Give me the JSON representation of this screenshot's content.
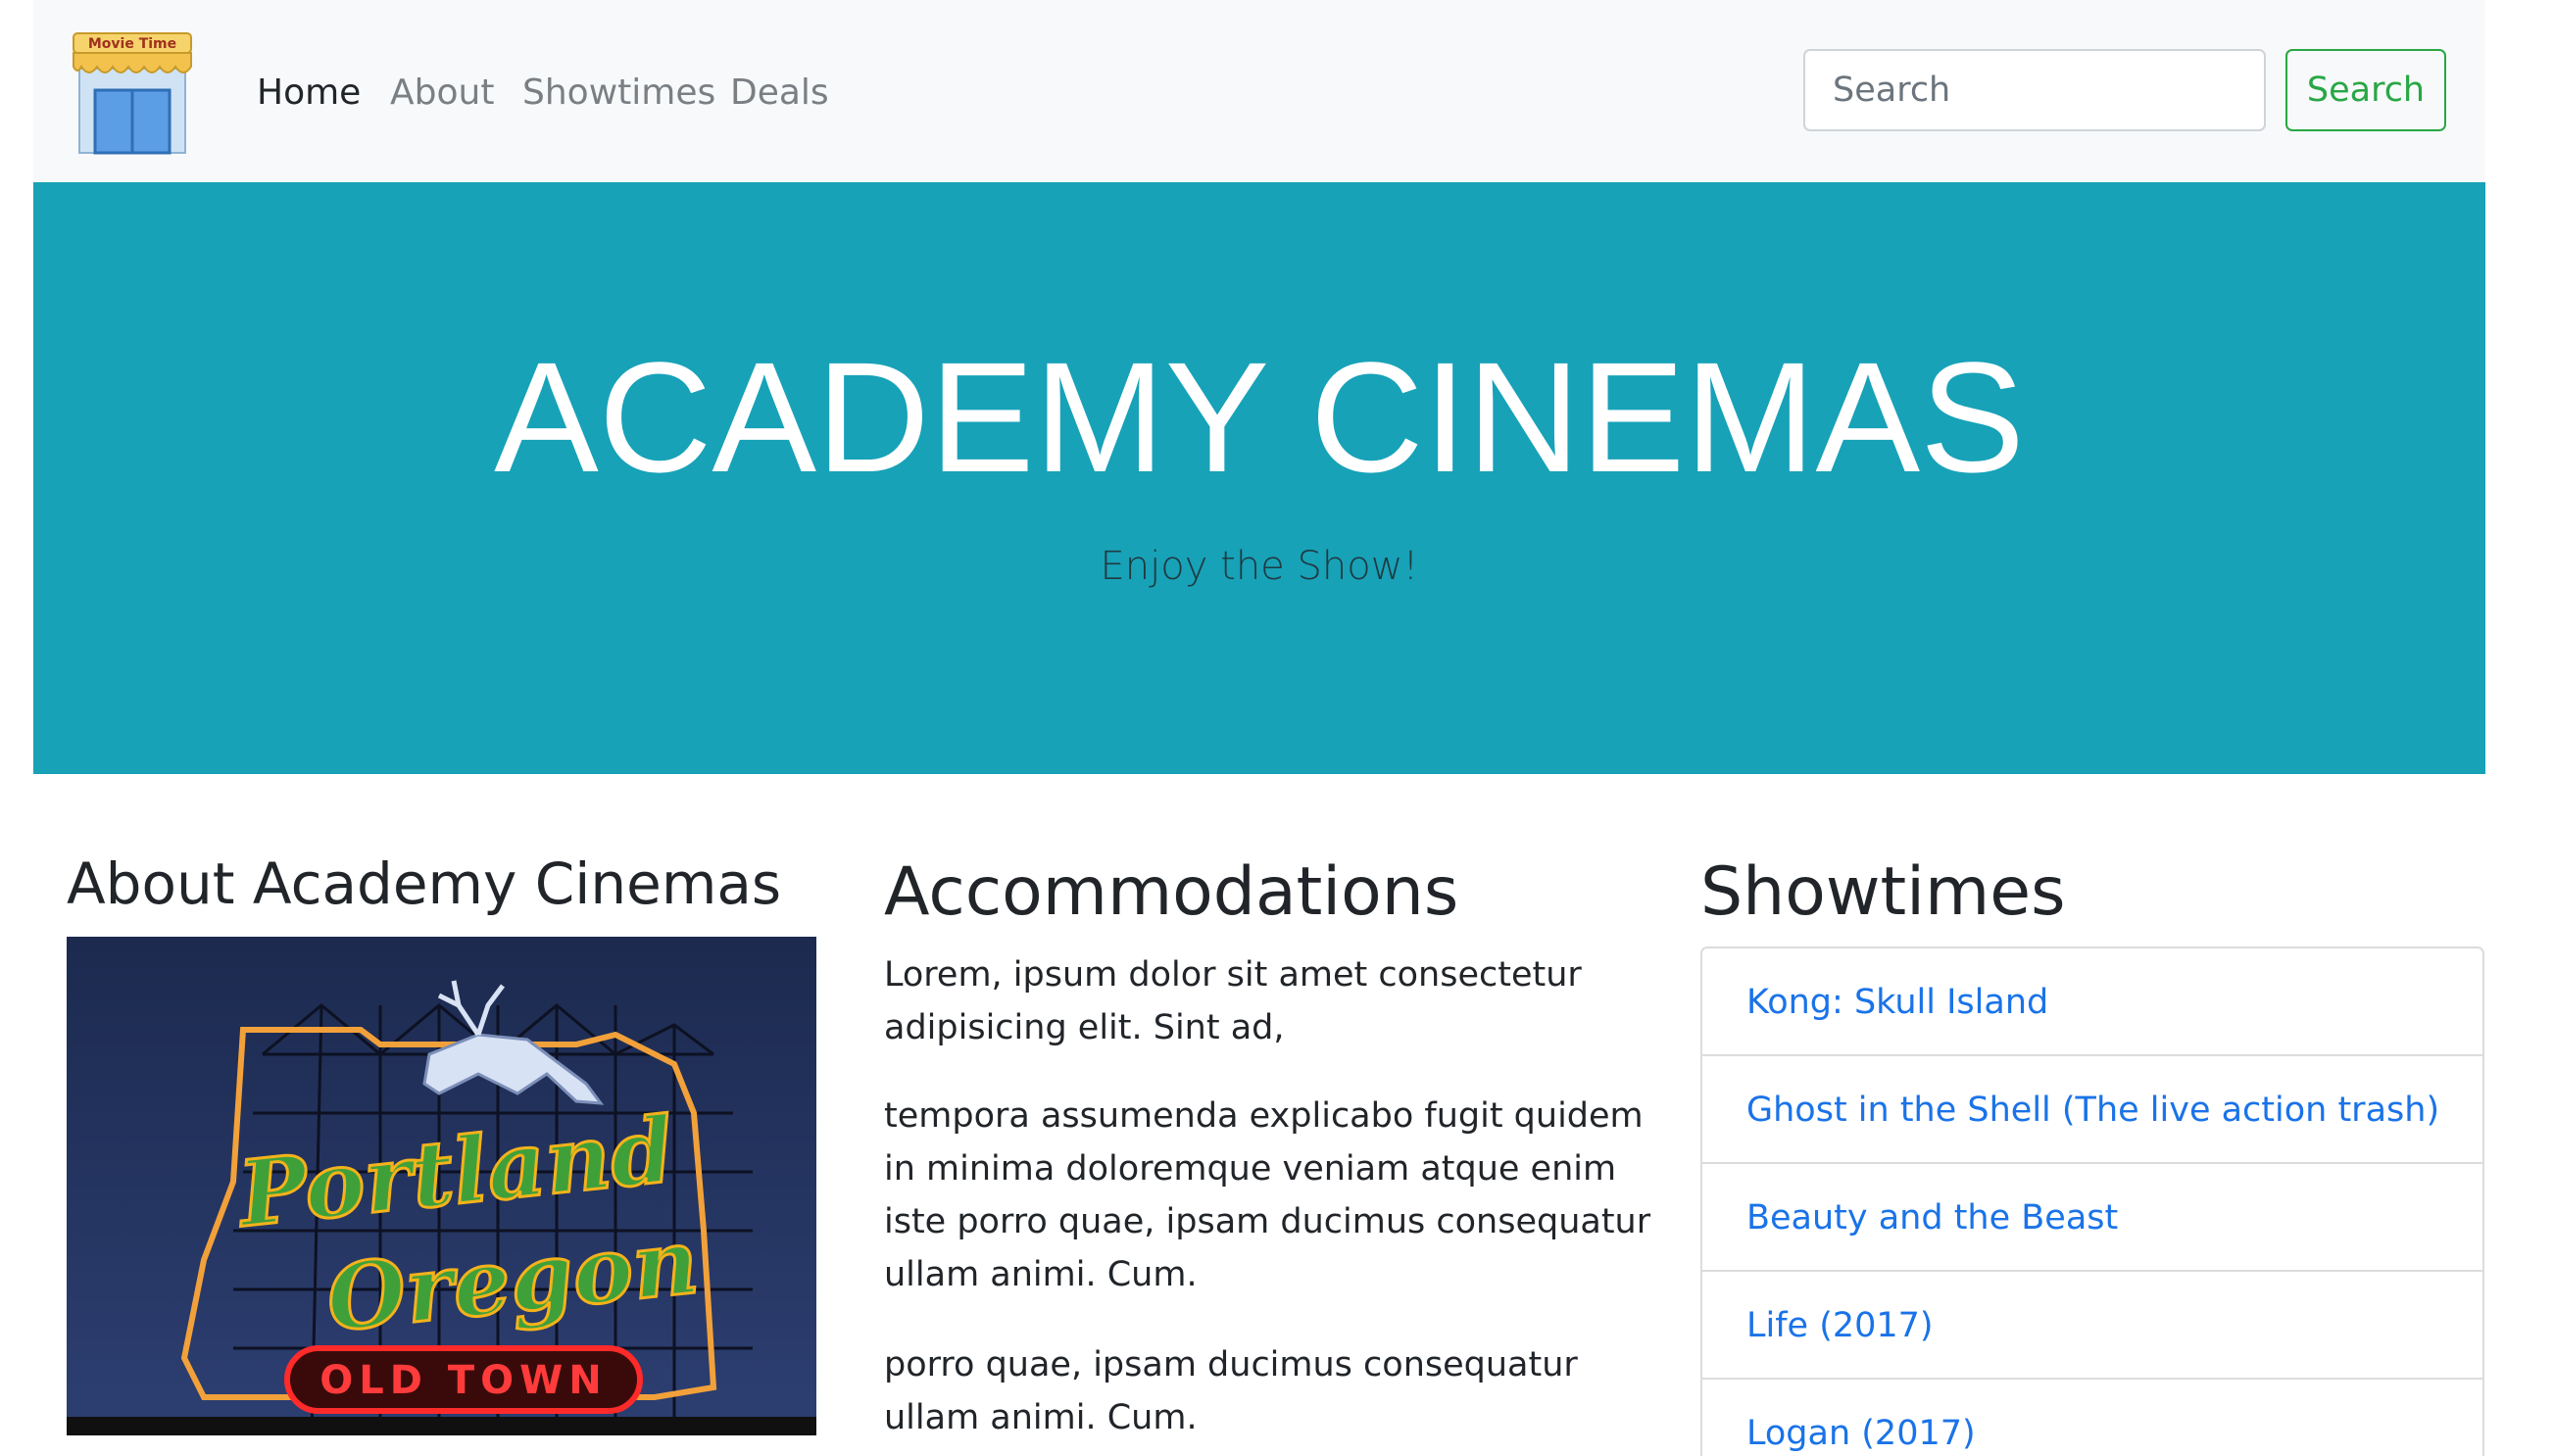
{
  "navbar": {
    "logo_text": "Movie Time",
    "links": [
      {
        "label": "Home",
        "active": true
      },
      {
        "label": "About",
        "active": false
      },
      {
        "label": "Showtimes",
        "active": false
      },
      {
        "label": "Deals",
        "active": false
      }
    ],
    "search_placeholder": "Search",
    "search_button": "Search"
  },
  "hero": {
    "title": "ACADEMY CINEMAS",
    "tagline": "Enjoy the Show!"
  },
  "about": {
    "heading": "About Academy Cinemas",
    "photo_sign_text": [
      "Portland",
      "Oregon",
      "OLD TOWN"
    ]
  },
  "accommodations": {
    "heading": "Accommodations",
    "paragraphs": [
      "Lorem, ipsum dolor sit amet consectetur adipisicing elit. Sint ad,",
      "tempora assumenda explicabo fugit quidem in minima doloremque veniam atque enim iste porro quae, ipsam ducimus consequatur ullam animi. Cum.",
      "porro quae, ipsam ducimus consequatur ullam animi. Cum."
    ]
  },
  "showtimes": {
    "heading": "Showtimes",
    "movies": [
      "Kong: Skull Island",
      "Ghost in the Shell (The live action trash)",
      "Beauty and the Beast",
      "Life (2017)",
      "Logan (2017)"
    ]
  },
  "colors": {
    "navbar_bg": "#f8f9fa",
    "hero_bg": "#17a2b8",
    "success": "#28a745",
    "link": "#1a73e8"
  }
}
